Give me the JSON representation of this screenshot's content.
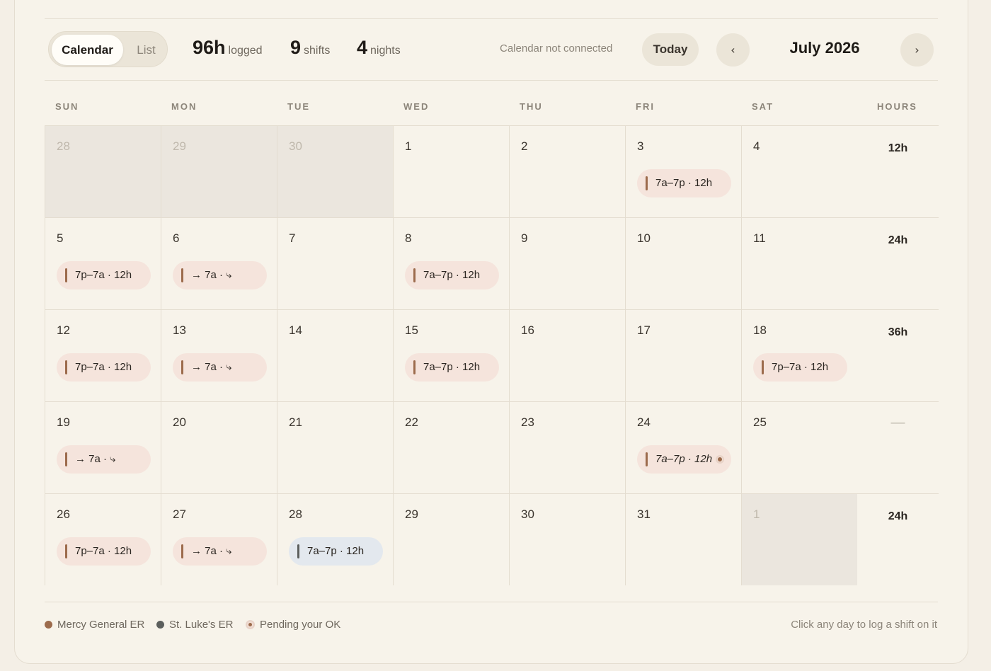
{
  "view_toggle": {
    "calendar_label": "Calendar",
    "list_label": "List",
    "active": "Calendar"
  },
  "stats": [
    {
      "value": "96h",
      "label": "logged"
    },
    {
      "value": "9",
      "label": "shifts"
    },
    {
      "value": "4",
      "label": "nights"
    }
  ],
  "sync_status": "Calendar not connected",
  "today_label": "Today",
  "prev_symbol": "‹",
  "next_symbol": "›",
  "month_title": "July 2026",
  "weekday_headers": [
    "SUN",
    "MON",
    "TUE",
    "WED",
    "THU",
    "FRI",
    "SAT"
  ],
  "hours_header": "HOURS",
  "weeks": [
    {
      "hours": "12h",
      "days": [
        {
          "date": "28",
          "outside": true
        },
        {
          "date": "29",
          "outside": true
        },
        {
          "date": "30",
          "outside": true
        },
        {
          "date": "1"
        },
        {
          "date": "2"
        },
        {
          "date": "3",
          "shift": {
            "text": "7a–7p · 12h",
            "site": "Mercy General ER"
          }
        },
        {
          "date": "4"
        }
      ]
    },
    {
      "hours": "24h",
      "days": [
        {
          "date": "5",
          "shift": {
            "text": "7p–7a · 12h",
            "site": "Mercy General ER"
          }
        },
        {
          "date": "6",
          "shift": {
            "text": "→ 7a · ⤷",
            "site": "Mercy General ER"
          }
        },
        {
          "date": "7"
        },
        {
          "date": "8",
          "shift": {
            "text": "7a–7p · 12h",
            "site": "Mercy General ER"
          }
        },
        {
          "date": "9"
        },
        {
          "date": "10"
        },
        {
          "date": "11"
        }
      ]
    },
    {
      "hours": "36h",
      "days": [
        {
          "date": "12",
          "shift": {
            "text": "7p–7a · 12h",
            "site": "Mercy General ER"
          }
        },
        {
          "date": "13",
          "shift": {
            "text": "→ 7a · ⤷",
            "site": "Mercy General ER"
          }
        },
        {
          "date": "14"
        },
        {
          "date": "15",
          "shift": {
            "text": "7a–7p · 12h",
            "site": "Mercy General ER"
          }
        },
        {
          "date": "16"
        },
        {
          "date": "17"
        },
        {
          "date": "18",
          "shift": {
            "text": "7p–7a · 12h",
            "site": "Mercy General ER"
          }
        }
      ]
    },
    {
      "hours": "—",
      "days": [
        {
          "date": "19",
          "shift": {
            "text": "→ 7a · ⤷",
            "site": "Mercy General ER"
          }
        },
        {
          "date": "20"
        },
        {
          "date": "21"
        },
        {
          "date": "22"
        },
        {
          "date": "23"
        },
        {
          "date": "24",
          "shift": {
            "text": "7a–7p · 12h",
            "site": "Mercy General ER",
            "pending": true
          }
        },
        {
          "date": "25"
        }
      ]
    },
    {
      "hours": "24h",
      "days": [
        {
          "date": "26",
          "shift": {
            "text": "7p–7a · 12h",
            "site": "Mercy General ER"
          }
        },
        {
          "date": "27",
          "shift": {
            "text": "→ 7a · ⤷",
            "site": "Mercy General ER"
          }
        },
        {
          "date": "28",
          "shift": {
            "text": "7a–7p · 12h",
            "site": "St. Luke's ER"
          }
        },
        {
          "date": "29"
        },
        {
          "date": "30"
        },
        {
          "date": "31"
        },
        {
          "date": "1",
          "outside": true
        }
      ]
    }
  ],
  "legend": [
    {
      "label": "Mercy General ER",
      "color": "#9c6b4c"
    },
    {
      "label": "St. Luke's ER",
      "color": "#5c5f5d"
    },
    {
      "label": "Pending your OK",
      "color": "#9c6b4c"
    }
  ],
  "hint": "Click any day to log a shift on it"
}
